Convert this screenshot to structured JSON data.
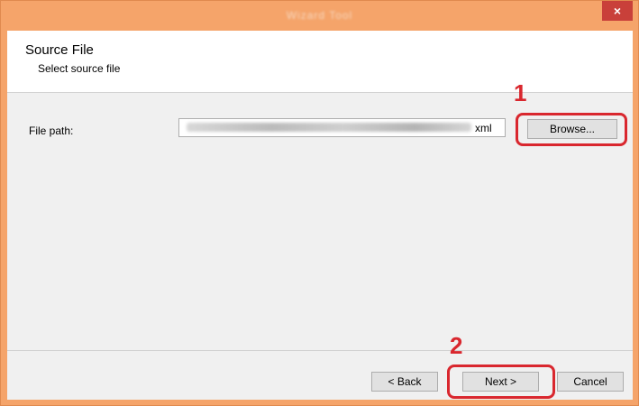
{
  "window": {
    "title": "Wizard Tool",
    "close_glyph": "×"
  },
  "header": {
    "title": "Source File",
    "subtitle": "Select source file"
  },
  "form": {
    "file_path_label": "File path:",
    "file_path_value_suffix": "xml",
    "browse_label": "Browse..."
  },
  "footer": {
    "back_label": "< Back",
    "next_label": "Next >",
    "cancel_label": "Cancel"
  },
  "annotations": {
    "step1": "1",
    "step2": "2",
    "color": "#d9272e"
  },
  "icons": {
    "close": "close-icon"
  }
}
